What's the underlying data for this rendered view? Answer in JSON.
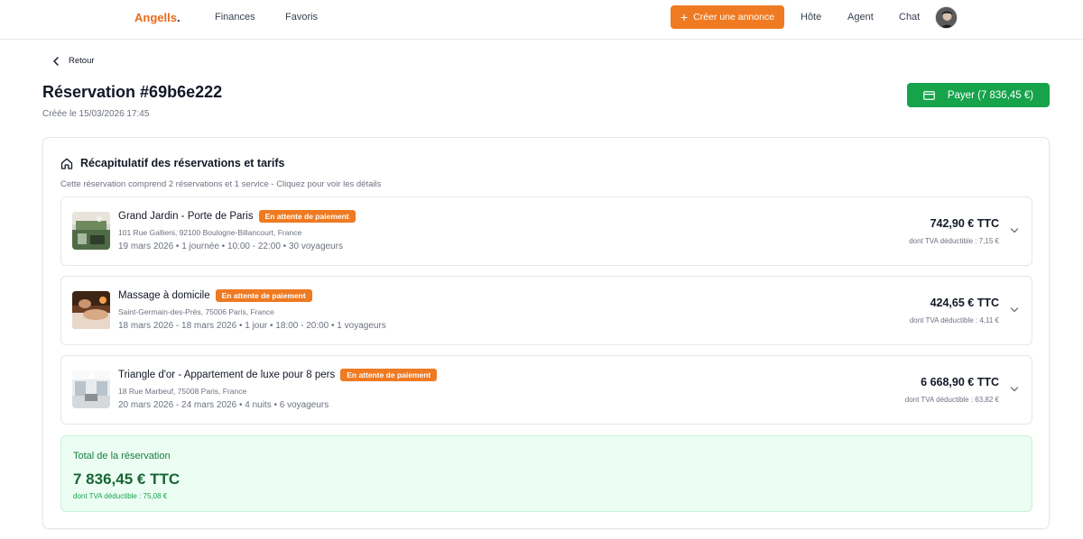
{
  "header": {
    "logo_text": "Angells",
    "logo_dot": ".",
    "nav": [
      "Finances",
      "Favoris"
    ],
    "cta_label": "Créer une annonce",
    "right_nav": [
      "Hôte",
      "Agent",
      "Chat"
    ],
    "accent": "#ef7a22"
  },
  "page": {
    "back_label": "Retour",
    "title": "Réservation #69b6e222",
    "created": "Créée le 15/03/2026 17:45",
    "pay_label": "Payer (7 836,45 €)"
  },
  "summary": {
    "title": "Récapitulatif des réservations et tarifs",
    "subtitle": "Cette réservation comprend 2 réservations et 1 service - Cliquez pour voir les détails",
    "items": [
      {
        "name": "Grand Jardin - Porte de Paris",
        "status": "En attente de paiement",
        "address": "101 Rue Gallieni, 92100 Boulogne-Billancourt, France",
        "details": "19 mars 2026 • 1 journée • 10:00 - 22:00 • 30 voyageurs",
        "price": "742,90 € TTC",
        "tva": "dont TVA déductible : 7,15 €"
      },
      {
        "name": "Massage à domicile",
        "status": "En attente de paiement",
        "address": "Saint-Germain-des-Prés, 75006 Paris, France",
        "details": "18 mars 2026 - 18 mars 2026 • 1 jour • 18:00 - 20:00 • 1 voyageurs",
        "price": "424,65 € TTC",
        "tva": "dont TVA déductible : 4,11 €"
      },
      {
        "name": "Triangle d'or - Appartement de luxe pour 8 pers",
        "status": "En attente de paiement",
        "address": "18 Rue Marbeuf, 75008 Paris, France",
        "details": "20 mars 2026 - 24 mars 2026 • 4 nuits • 6 voyageurs",
        "price": "6 668,90 € TTC",
        "tva": "dont TVA déductible : 63,82 €"
      }
    ],
    "total_label": "Total de la réservation",
    "total_value": "7 836,45 € TTC",
    "total_tva": "dont TVA déductible : 75,08 €"
  }
}
